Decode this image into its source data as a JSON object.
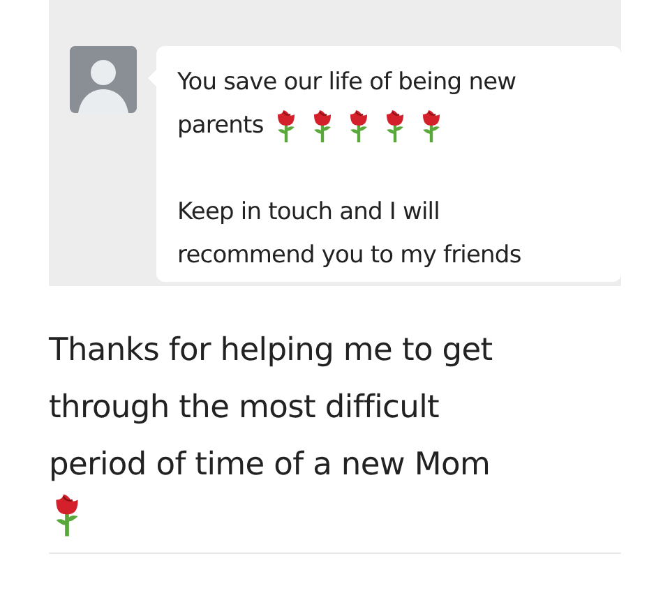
{
  "chat_card": {
    "message": {
      "paragraphs": [
        {
          "lines": [
            "You save our life of being new",
            "parents"
          ],
          "emoji": [
            {
              "kind": "rose"
            },
            {
              "kind": "rose"
            },
            {
              "kind": "rose"
            },
            {
              "kind": "rose"
            },
            {
              "kind": "rose"
            }
          ]
        },
        {
          "lines": [
            "Keep in touch and I will",
            "recommend you to my friends"
          ]
        }
      ]
    }
  },
  "review": {
    "lines": [
      "Thanks for helping me to get",
      "through the most difficult",
      "period of time of a new Mom"
    ],
    "emoji": [
      {
        "kind": "rose"
      }
    ]
  }
}
